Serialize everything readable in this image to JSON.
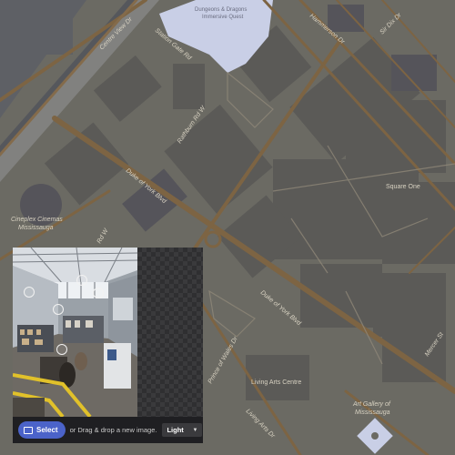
{
  "map": {
    "labels": {
      "centre_view": "Centre View Dr",
      "station_gate": "Station Gate Rd",
      "rathburn": "Rathburn Rd W",
      "hammerson": "Hammerson Dr",
      "sir_dix": "Sir Dix Dr",
      "duke_of_york_1": "Duke of York Blvd",
      "duke_of_york_2": "Duke of York Blvd",
      "square_one": "Square One",
      "cineplex": "Cineplex Cinemas",
      "cineplex_2": "Mississauga",
      "rd_w": "Rd W",
      "prince_of_wales": "Prince of Wales Dr",
      "living_arts_centre": "Living Arts Centre",
      "living_arts_dr": "Living Arts Dr",
      "art_gallery": "Art Gallery of",
      "art_gallery_2": "Mississauga",
      "mercer": "Mercer St",
      "poi_1": "Dungeons & Dragons",
      "poi_2": "Immersive Quest"
    }
  },
  "viewer": {
    "select_label": "Select",
    "hint": "or Drag & drop a new image.",
    "theme_value": "Light"
  },
  "colors": {
    "accent": "#4b63c9",
    "road": "#8a6a45",
    "building": "#5a5a5a",
    "highlight": "#c9cfe6"
  }
}
